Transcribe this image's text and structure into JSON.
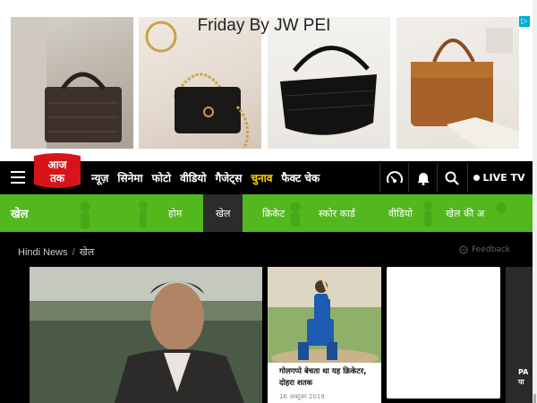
{
  "ad": {
    "title": "Friday By JW PEI",
    "choices_icon": "adchoices-icon",
    "images": [
      "brown-crocodile-bag-photo",
      "black-chain-bag-photo",
      "black-croc-shoulder-bag-photo",
      "tan-handbag-photo"
    ]
  },
  "header": {
    "logo_text": "आज तक",
    "nav": [
      "न्यूज़",
      "सिनेमा",
      "फोटो",
      "वीडियो",
      "गैजेट्स",
      "चुनाव",
      "फैक्ट चेक"
    ],
    "highlight_index": 5,
    "icons": [
      "podcast-icon",
      "bell-icon",
      "search-icon"
    ],
    "live_label": "LIVE TV"
  },
  "section": {
    "title": "खेल",
    "tabs": [
      "होम",
      "खेल",
      "क्रिकेट",
      "स्कोर कार्ड",
      "वीडियो",
      "खेल की अ"
    ],
    "active_index": 1,
    "color": "#52b81e"
  },
  "breadcrumb": {
    "home": "Hindi News",
    "current": "खेल",
    "feedback": "Feedback"
  },
  "cards": {
    "mid": {
      "headline": "गोलगप्पे बेचता था यह क्रिकेटर, दोहरा शतक",
      "date": "16 अक्टूबर 2019"
    },
    "right": {
      "text_line1": "PA",
      "text_line2": "पा"
    }
  }
}
